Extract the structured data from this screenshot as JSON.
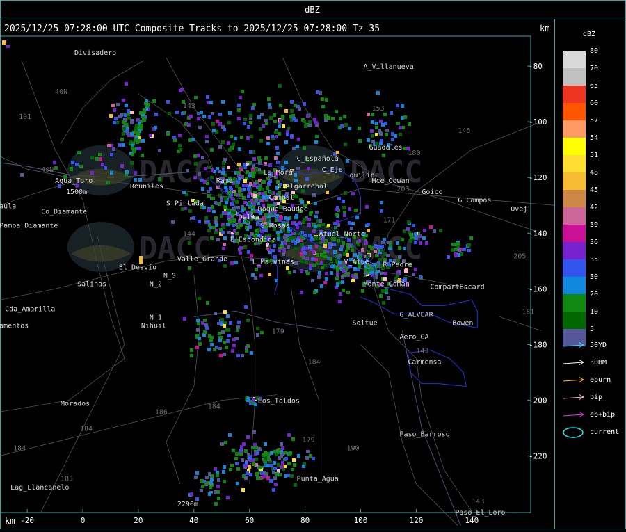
{
  "title_bar": "dBZ",
  "header": "2025/12/25 07:28:00 UTC Composite Tracks to 2025/12/25 07:28:00 Tz 35",
  "km_right": "km",
  "km_left": "km",
  "x_ticks": [
    "-20",
    "0",
    "20",
    "40",
    "60",
    "80",
    "100",
    "120",
    "140"
  ],
  "y_ticks": [
    "-80",
    "-100",
    "-120",
    "-140",
    "-160",
    "-180",
    "-200",
    "-220"
  ],
  "legend": {
    "title": "dBZ",
    "levels": [
      {
        "label": "80",
        "color": "#d8d8d8"
      },
      {
        "label": "70",
        "color": "#c0c0c0"
      },
      {
        "label": "65",
        "color": "#ee3322"
      },
      {
        "label": "60",
        "color": "#ff5500"
      },
      {
        "label": "57",
        "color": "#ff9966"
      },
      {
        "label": "54",
        "color": "#ffff00"
      },
      {
        "label": "51",
        "color": "#ffdd33"
      },
      {
        "label": "48",
        "color": "#f4bb33"
      },
      {
        "label": "45",
        "color": "#cc8844"
      },
      {
        "label": "42",
        "color": "#cc6699"
      },
      {
        "label": "39",
        "color": "#cc1199"
      },
      {
        "label": "36",
        "color": "#7722cc"
      },
      {
        "label": "35",
        "color": "#3355ee"
      },
      {
        "label": "30",
        "color": "#1188dd"
      },
      {
        "label": "20",
        "color": "#118811"
      },
      {
        "label": "10",
        "color": "#006600"
      },
      {
        "label": "5",
        "color": "#555599"
      }
    ],
    "tracks": [
      {
        "label": "50YD",
        "color": "#33ddee"
      },
      {
        "label": "30HM",
        "color": "#ffffff"
      },
      {
        "label": "eburn",
        "color": "#ffbb33"
      },
      {
        "label": "bip",
        "color": "#ffbbcc"
      },
      {
        "label": "eb+bip",
        "color": "#ee33ee"
      },
      {
        "label": "current",
        "color": "#33ddee"
      }
    ]
  },
  "places": [
    {
      "name": "Divisadero",
      "lon": -3,
      "lat": -76
    },
    {
      "name": "A_Villanueva",
      "lon": 101,
      "lat": -81
    },
    {
      "name": "Guadales",
      "lon": 103,
      "lat": -110
    },
    {
      "name": "C_Española",
      "lon": 77,
      "lat": -114
    },
    {
      "name": "C_Eje",
      "lon": 86,
      "lat": -118
    },
    {
      "name": "quilin",
      "lon": 96,
      "lat": -120
    },
    {
      "name": "Hce_Cowan",
      "lon": 104,
      "lat": -122
    },
    {
      "name": "Goico",
      "lon": 122,
      "lat": -126
    },
    {
      "name": "G_Campos",
      "lon": 135,
      "lat": -129
    },
    {
      "name": "Ovej",
      "lon": 154,
      "lat": -132
    },
    {
      "name": "La_Mora",
      "lon": 65,
      "lat": -119
    },
    {
      "name": "C_Algarrobal",
      "lon": 70,
      "lat": -124
    },
    {
      "name": "Rama",
      "lon": 48,
      "lat": -122
    },
    {
      "name": "Agua_Toro",
      "lon": -10,
      "lat": -122
    },
    {
      "name": "1500m",
      "lon": -6,
      "lat": -126
    },
    {
      "name": "Co_Diamante",
      "lon": -15,
      "lat": -133
    },
    {
      "name": "aula",
      "lon": -30,
      "lat": -131
    },
    {
      "name": "Pampa_Diamante",
      "lon": -30,
      "lat": -138
    },
    {
      "name": "S_Pintada",
      "lon": 30,
      "lat": -130
    },
    {
      "name": "Reuniles",
      "lon": 17,
      "lat": -124
    },
    {
      "name": "Combal",
      "lon": 67,
      "lat": -128
    },
    {
      "name": "Roque_Baudge",
      "lon": 63,
      "lat": -132
    },
    {
      "name": "Delba",
      "lon": 56,
      "lat": -135
    },
    {
      "name": "S_Rosas",
      "lon": 64,
      "lat": -138
    },
    {
      "name": "Atuel_Norte",
      "lon": 85,
      "lat": -141
    },
    {
      "name": "E_Escondida",
      "lon": 53,
      "lat": -143
    },
    {
      "name": "Valle_Grande",
      "lon": 34,
      "lat": -150
    },
    {
      "name": "L_Malvinas",
      "lon": 61,
      "lat": -151
    },
    {
      "name": "V_Atuel",
      "lon": 94,
      "lat": -151
    },
    {
      "name": "R_Padre",
      "lon": 108,
      "lat": -152
    },
    {
      "name": "El_Desvio",
      "lon": 13,
      "lat": -153
    },
    {
      "name": "N_S",
      "lon": 29,
      "lat": -156
    },
    {
      "name": "N_2",
      "lon": 24,
      "lat": -159
    },
    {
      "name": "Salinas",
      "lon": -2,
      "lat": -159
    },
    {
      "name": "Monte_Comán",
      "lon": 101,
      "lat": -159
    },
    {
      "name": "CompartEscard",
      "lon": 125,
      "lat": -160
    },
    {
      "name": "Cda_Amarilla",
      "lon": -28,
      "lat": -168
    },
    {
      "name": "N_1",
      "lon": 24,
      "lat": -171
    },
    {
      "name": "Nihuil",
      "lon": 21,
      "lat": -174
    },
    {
      "name": "amentos",
      "lon": -30,
      "lat": -174
    },
    {
      "name": "G_ALVEAR",
      "lon": 114,
      "lat": -170
    },
    {
      "name": "Soitue",
      "lon": 97,
      "lat": -173
    },
    {
      "name": "Bowen",
      "lon": 133,
      "lat": -173
    },
    {
      "name": "Aero_GA",
      "lon": 114,
      "lat": -178
    },
    {
      "name": "Carmensa",
      "lon": 117,
      "lat": -187
    },
    {
      "name": "Morados",
      "lon": -8,
      "lat": -202
    },
    {
      "name": "Los_Toldos",
      "lon": 63,
      "lat": -201
    },
    {
      "name": "Paso_Barroso",
      "lon": 114,
      "lat": -213
    },
    {
      "name": "Punta_Agua",
      "lon": 77,
      "lat": -229
    },
    {
      "name": "Lag_Llancanelo",
      "lon": -26,
      "lat": -232
    },
    {
      "name": "2290m",
      "lon": 34,
      "lat": -238
    },
    {
      "name": "Paso_El_Loro",
      "lon": 134,
      "lat": -241
    }
  ],
  "road_numbers": [
    {
      "name": "101",
      "lon": -23,
      "lat": -99
    },
    {
      "name": "40N",
      "lon": -10,
      "lat": -90
    },
    {
      "name": "40N",
      "lon": -15,
      "lat": -118
    },
    {
      "name": "143",
      "lon": 36,
      "lat": -95
    },
    {
      "name": "153",
      "lon": 104,
      "lat": -96
    },
    {
      "name": "146",
      "lon": 135,
      "lat": -104
    },
    {
      "name": "180",
      "lon": 117,
      "lat": -112
    },
    {
      "name": "203",
      "lon": 113,
      "lat": -125
    },
    {
      "name": "171",
      "lon": 108,
      "lat": -136
    },
    {
      "name": "144",
      "lon": 36,
      "lat": -141
    },
    {
      "name": "205",
      "lon": 155,
      "lat": -149
    },
    {
      "name": "179",
      "lon": 68,
      "lat": -176
    },
    {
      "name": "184",
      "lon": 81,
      "lat": -187
    },
    {
      "name": "143",
      "lon": 120,
      "lat": -183
    },
    {
      "name": "186",
      "lon": 26,
      "lat": -205
    },
    {
      "name": "184",
      "lon": 45,
      "lat": -203
    },
    {
      "name": "184",
      "lon": -1,
      "lat": -211
    },
    {
      "name": "179",
      "lon": 79,
      "lat": -215
    },
    {
      "name": "190",
      "lon": 95,
      "lat": -218
    },
    {
      "name": "184",
      "lon": -25,
      "lat": -218
    },
    {
      "name": "183",
      "lon": -8,
      "lat": -229
    },
    {
      "name": "143",
      "lon": 140,
      "lat": -237
    },
    {
      "name": "181",
      "lon": 158,
      "lat": -169
    }
  ]
}
